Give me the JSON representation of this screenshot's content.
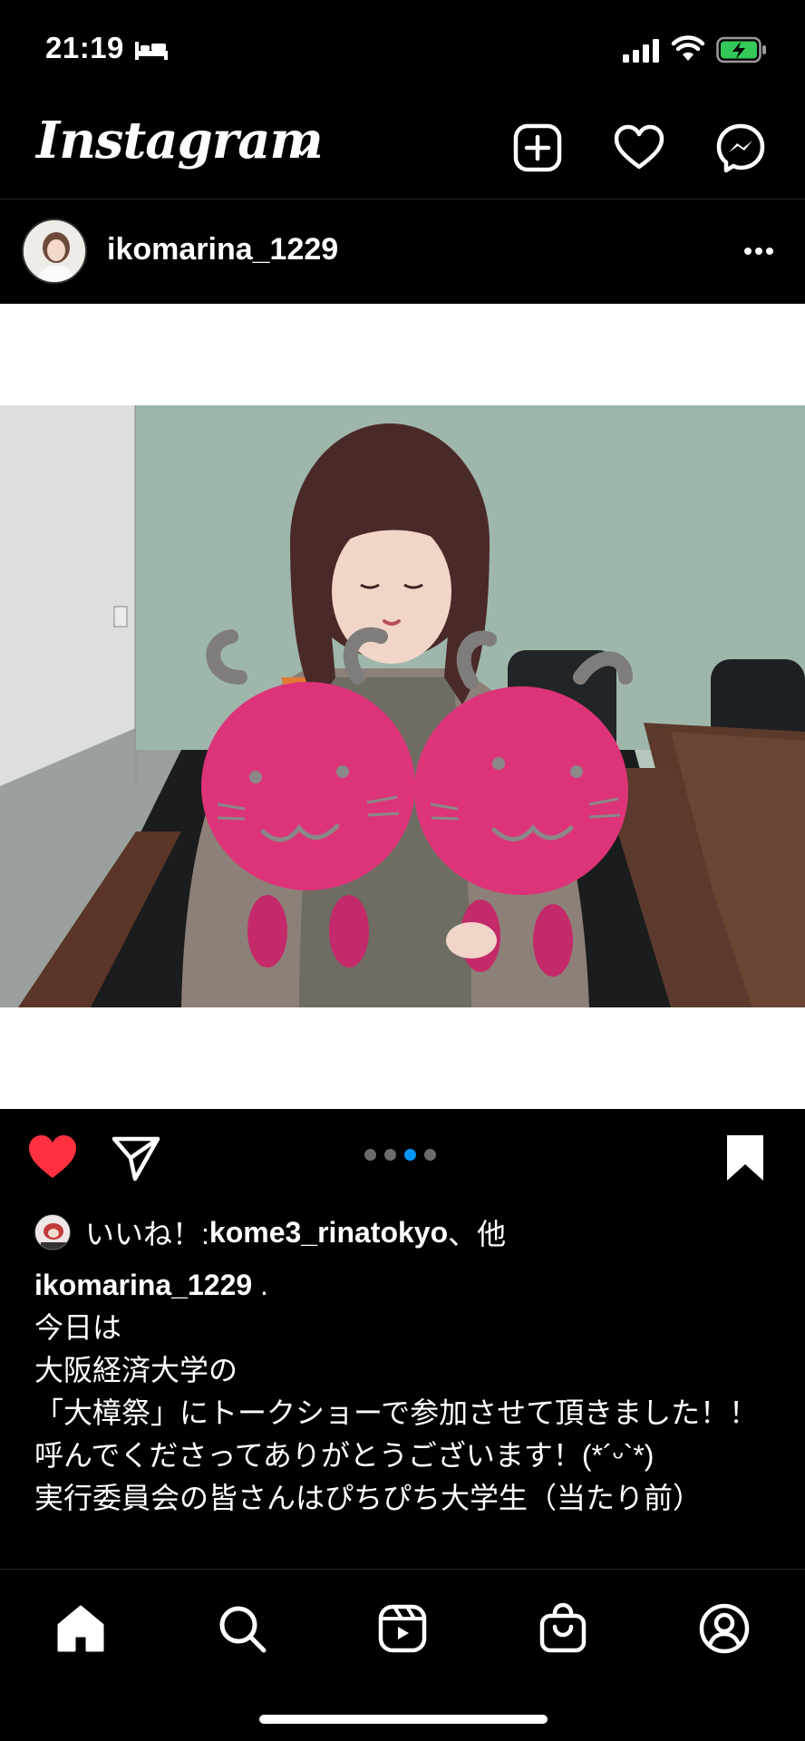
{
  "status_bar": {
    "time": "21:19",
    "icons": [
      "bed-icon",
      "signal-icon",
      "wifi-icon",
      "battery-charging-icon"
    ]
  },
  "header": {
    "logo": "Instagram",
    "icons": [
      "chevron-down-icon",
      "new-post-icon",
      "heart-icon",
      "messenger-icon"
    ]
  },
  "post": {
    "username": "ikomarina_1229",
    "carousel": {
      "count": 4,
      "active_index": 2
    },
    "liked": true,
    "saved": true,
    "likes": {
      "prefix": "いいね！: ",
      "user": "kome3_rinatokyo",
      "suffix": "、他"
    },
    "caption": {
      "username": "ikomarina_1229",
      "after_username": " .",
      "lines": [
        "今日は",
        "大阪経済大学の",
        "「大樟祭」にトークショーで参加させて頂きました！！",
        "呼んでくださってありがとうございます！(*´ᵕ`*)",
        "実行委員会の皆さんはぴちぴち大学生（当たり前）"
      ]
    }
  },
  "colors": {
    "background": "#000000",
    "like_red": "#ff3040",
    "carousel_active": "#0095f6",
    "plush_pink": "#e0337a"
  },
  "bottom_nav": {
    "items": [
      "home-icon",
      "search-icon",
      "reels-icon",
      "shop-icon",
      "profile-icon"
    ],
    "active": "home-icon"
  }
}
